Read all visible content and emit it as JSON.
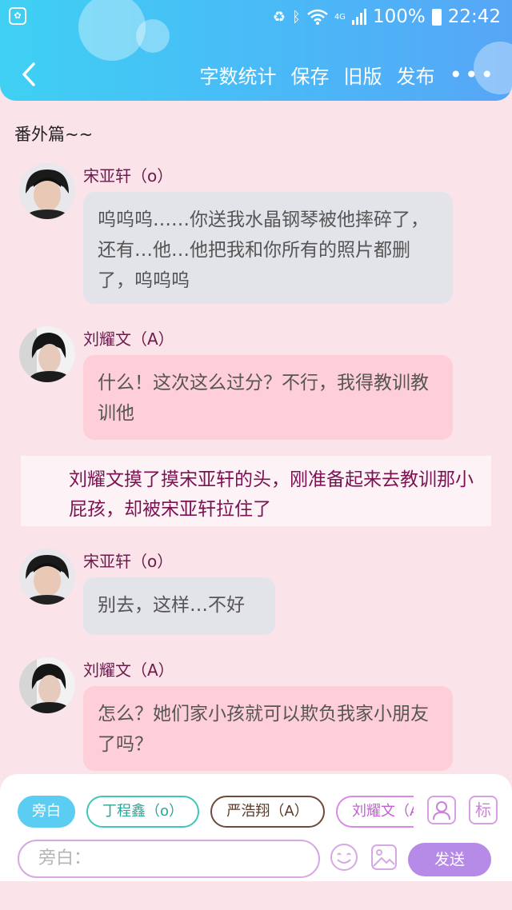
{
  "status_bar": {
    "app_icon": "baidu-paw-icon",
    "network": "4G",
    "battery": "100%",
    "time": "22:42"
  },
  "header": {
    "back_icon": "chevron-left-icon",
    "actions": [
      "字数统计",
      "保存",
      "旧版",
      "发布"
    ],
    "more_icon": "more-dots-icon",
    "more_label": "•••"
  },
  "chapter_title": "番外篇~~",
  "messages": [
    {
      "speaker": "宋亚轩（o）",
      "text": "呜呜呜……你送我水晶钢琴被他摔碎了，还有…他…他把我和你所有的照片都删了，呜呜呜",
      "style": "gray"
    },
    {
      "speaker": "刘耀文（A）",
      "text": "什么！这次这么过分？不行，我得教训教训他",
      "style": "pink"
    },
    {
      "speaker": "宋亚轩（o）",
      "text": "别去，这样…不好",
      "style": "gray"
    },
    {
      "speaker": "刘耀文（A）",
      "text": "怎么？她们家小孩就可以欺负我家小朋友了吗？",
      "style": "pink"
    }
  ],
  "narration": "刘耀文摸了摸宋亚轩的头，刚准备起来去教训那小屁孩，却被宋亚轩拉住了",
  "composer": {
    "roles": [
      "旁白",
      "丁程鑫（o）",
      "严浩翔（A）",
      "刘耀文（A）"
    ],
    "selected_role": "旁白",
    "role_button_icon": "person-icon",
    "tag_label": "标",
    "input_placeholder": "旁白：",
    "emoji_icon": "smiley-icon",
    "image_icon": "image-icon",
    "send_label": "发送"
  },
  "colors": {
    "header": "#4bb7f7",
    "background": "#fbe3ea",
    "gray_bubble": "#e3e4ea",
    "pink_bubble": "#ffcfd9",
    "send": "#b68be8"
  }
}
